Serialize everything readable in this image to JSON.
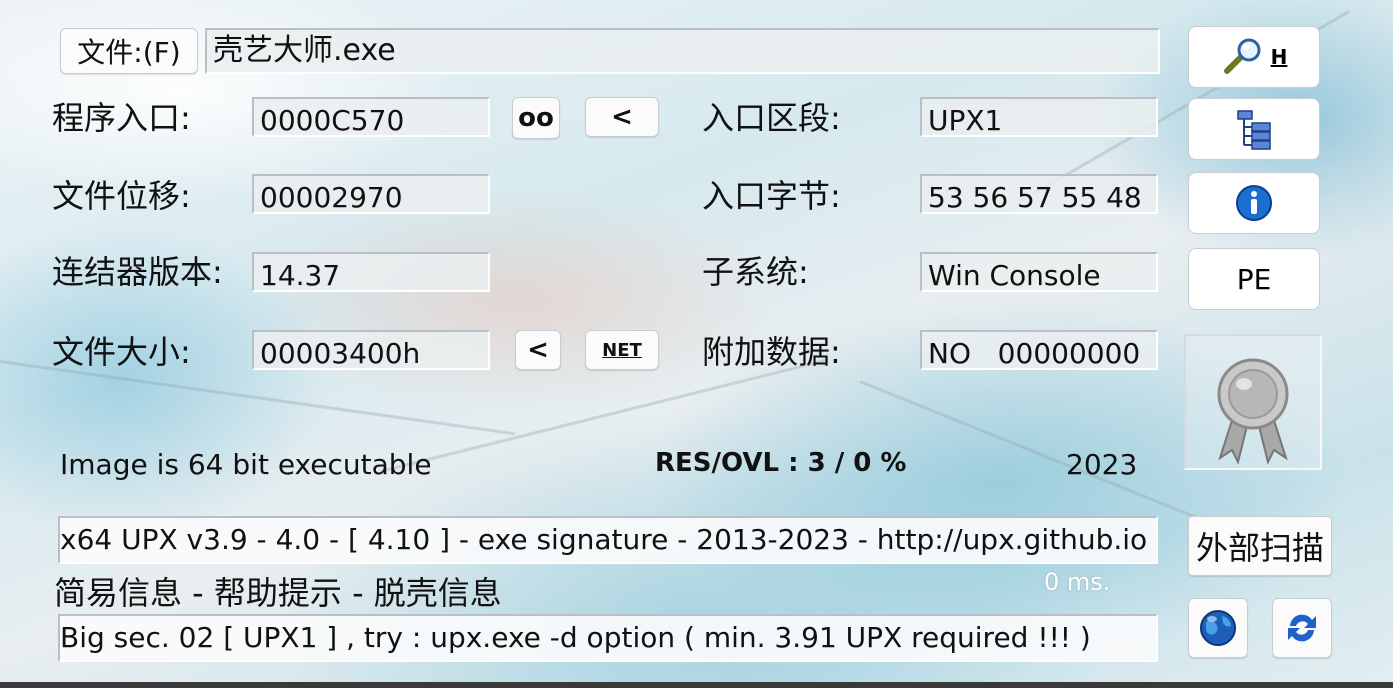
{
  "header": {
    "file_button_label": "文件:(F)",
    "file_name": "壳艺大师.exe"
  },
  "fields": {
    "entry_point_label": "程序入口:",
    "entry_point_value": "0000C570",
    "oo_button": "oo",
    "lt_button_1": "<",
    "file_offset_label": "文件位移:",
    "file_offset_value": "00002970",
    "linker_label": "连结器版本:",
    "linker_value": "14.37",
    "file_size_label": "文件大小:",
    "file_size_value": "00003400h",
    "lt_button_2": "<",
    "net_button": "NET",
    "entry_section_label": "入口区段:",
    "entry_section_value": "UPX1",
    "entry_bytes_label": "入口字节:",
    "entry_bytes_value": "53 56 57 55 48",
    "subsystem_label": "子系统:",
    "subsystem_value": "Win Console",
    "overlay_label": "附加数据:",
    "overlay_value": "NO   00000000"
  },
  "side_buttons": {
    "search_hotkey": "H",
    "pe_label": "PE",
    "external_scan_label": "外部扫描"
  },
  "status": {
    "image_bits": "Image is 64 bit executable",
    "res_ovl": "RES/OVL : 3 / 0 %",
    "year": "2023",
    "detection": " x64 UPX v3.9 - 4.0 - [ 4.10 ] - exe signature - 2013-2023 - http://upx.github.io",
    "info_links": "简易信息 - 帮助提示 - 脱壳信息",
    "timing": "0 ms.",
    "hint": "Big sec. 02 [ UPX1 ] , try : upx.exe -d option ( min. 3.91 UPX required !!! )"
  },
  "colors": {
    "info_blue": "#1a6fd1",
    "globe_blue": "#1e5fb8",
    "refresh_blue": "#1f62c9",
    "tree_blue": "#3f6fc5"
  }
}
